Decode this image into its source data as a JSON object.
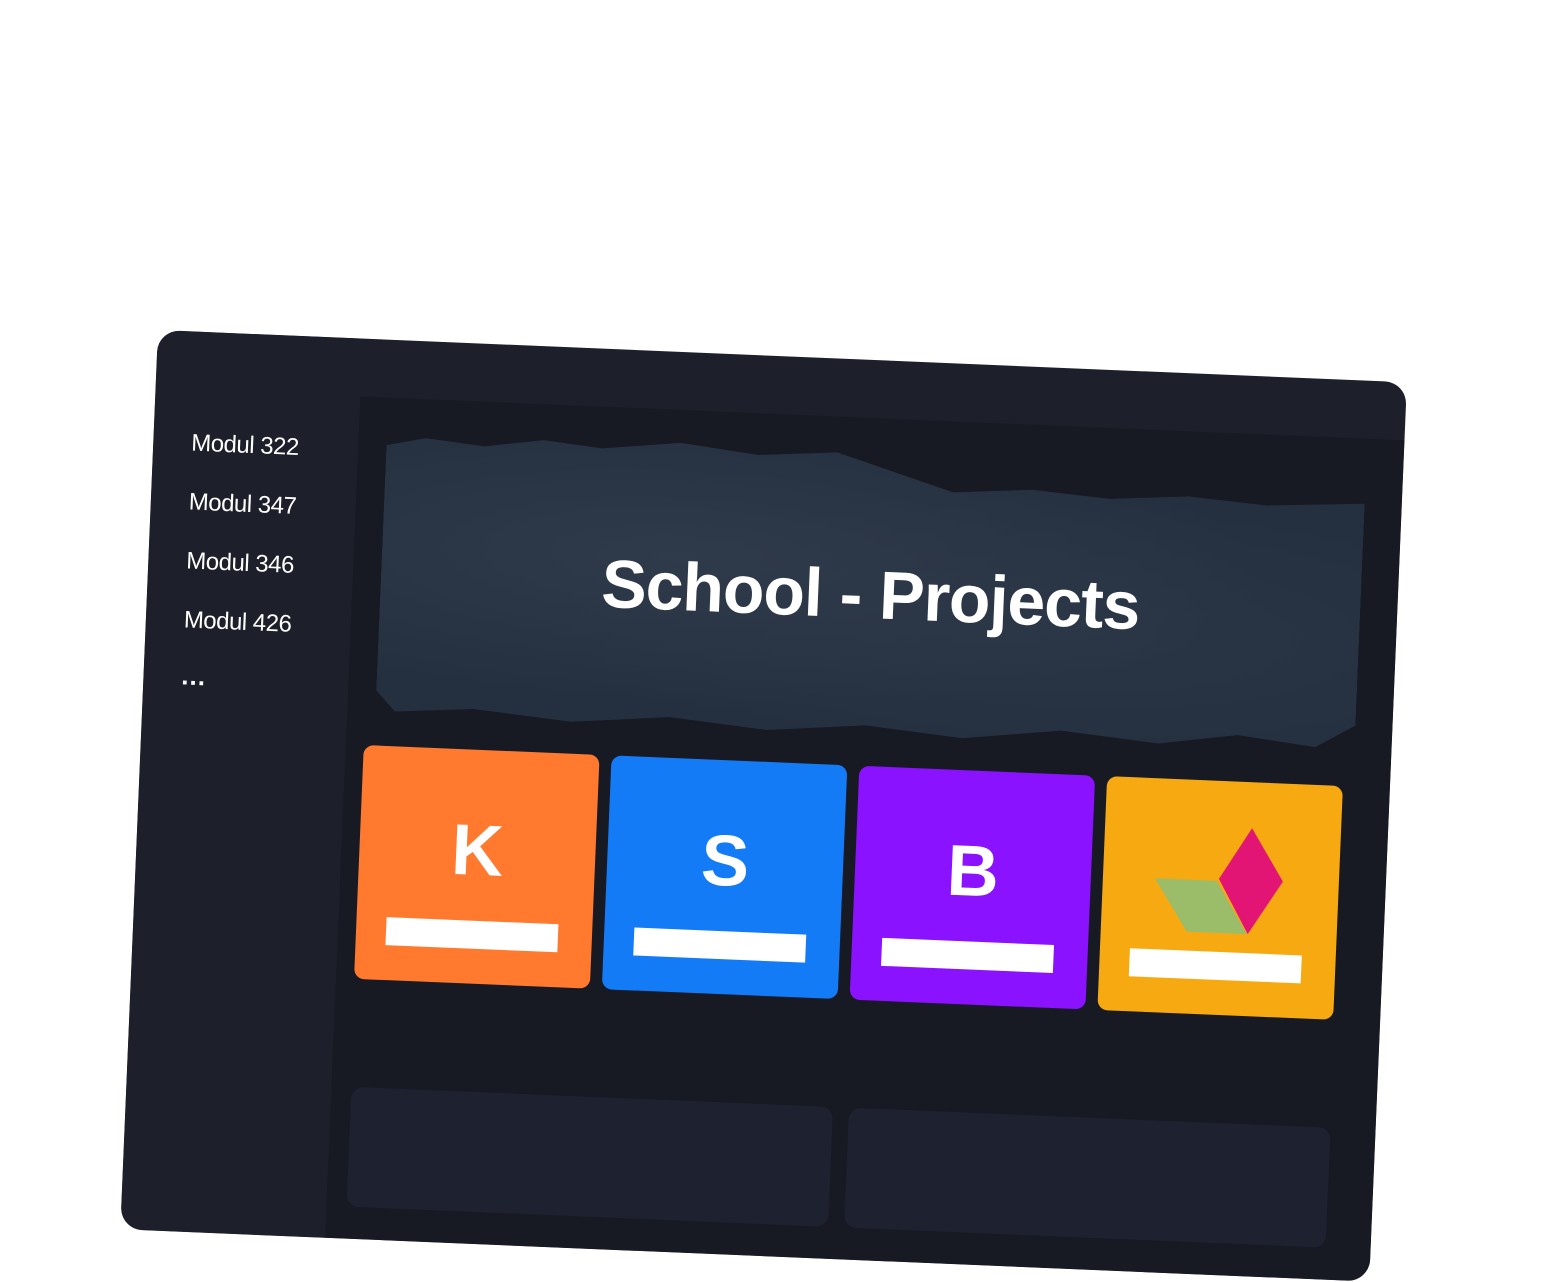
{
  "sidebar": {
    "items": [
      "Modul 322",
      "Modul 347",
      "Modul 346",
      "Modul 426"
    ],
    "more": "..."
  },
  "hero": {
    "title": "School - Projects"
  },
  "cards": [
    {
      "letter": "K",
      "color": "#ff7a2f"
    },
    {
      "letter": "S",
      "color": "#137bf6"
    },
    {
      "letter": "B",
      "color": "#8a12ff"
    },
    {
      "icon": "diamond-logo-icon",
      "color": "#f6a911"
    }
  ]
}
